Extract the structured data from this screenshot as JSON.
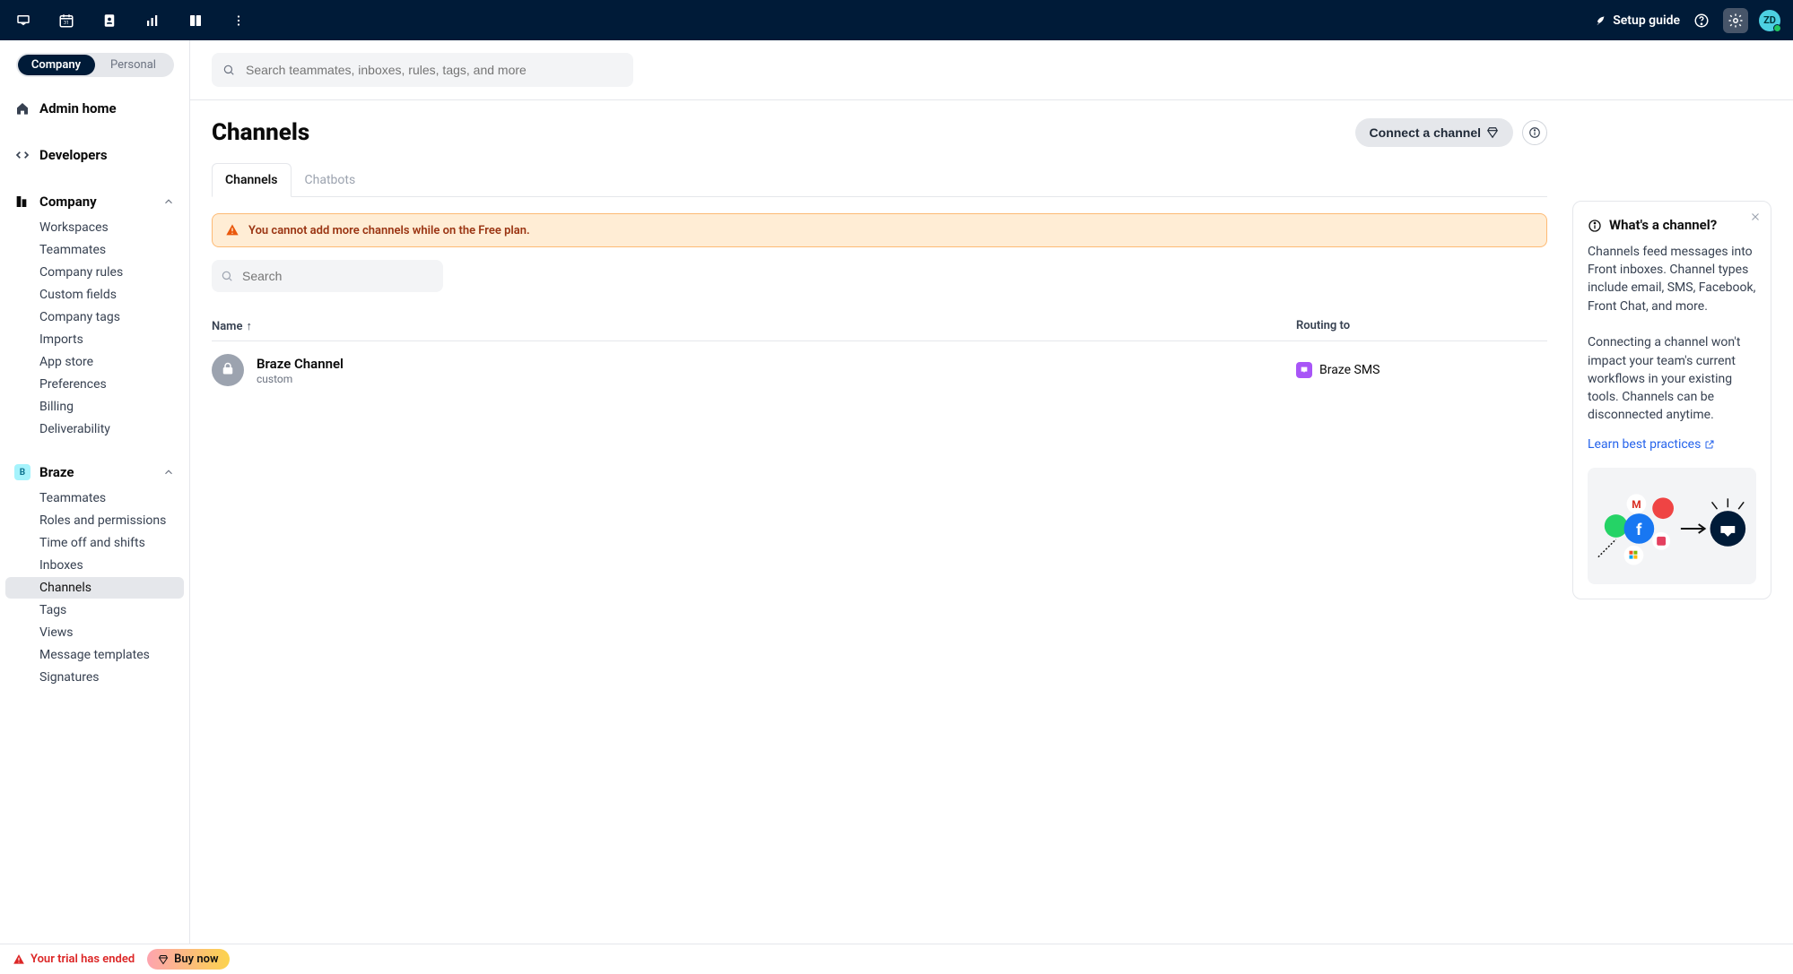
{
  "topbar": {
    "setup_guide": "Setup guide",
    "avatar": "ZD"
  },
  "scope": {
    "company": "Company",
    "personal": "Personal"
  },
  "sidebar": {
    "admin_home": "Admin home",
    "developers": "Developers",
    "company_section": "Company",
    "company_items": [
      "Workspaces",
      "Teammates",
      "Company rules",
      "Custom fields",
      "Company tags",
      "Imports",
      "App store",
      "Preferences",
      "Billing",
      "Deliverability"
    ],
    "workspace_badge": "B",
    "workspace_section": "Braze",
    "workspace_items": [
      "Teammates",
      "Roles and permissions",
      "Time off and shifts",
      "Inboxes",
      "Channels",
      "Tags",
      "Views",
      "Message templates",
      "Signatures"
    ]
  },
  "search": {
    "placeholder": "Search teammates, inboxes, rules, tags, and more"
  },
  "page": {
    "title": "Channels",
    "connect_btn": "Connect a channel",
    "tabs": [
      "Channels",
      "Chatbots"
    ],
    "alert": "You cannot add more channels while on the Free plan.",
    "small_search_placeholder": "Search",
    "col_name": "Name",
    "col_routing": "Routing to",
    "rows": [
      {
        "name": "Braze Channel",
        "type": "custom",
        "routing": "Braze SMS"
      }
    ]
  },
  "info": {
    "title": "What's a channel?",
    "p1": "Channels feed messages into Front inboxes. Channel types include email, SMS, Facebook, Front Chat, and more.",
    "p2": "Connecting a channel won't impact your team's current workflows in your existing tools. Channels can be disconnected anytime.",
    "learn": "Learn best practices"
  },
  "footer": {
    "trial": "Your trial has ended",
    "buy": "Buy now"
  }
}
